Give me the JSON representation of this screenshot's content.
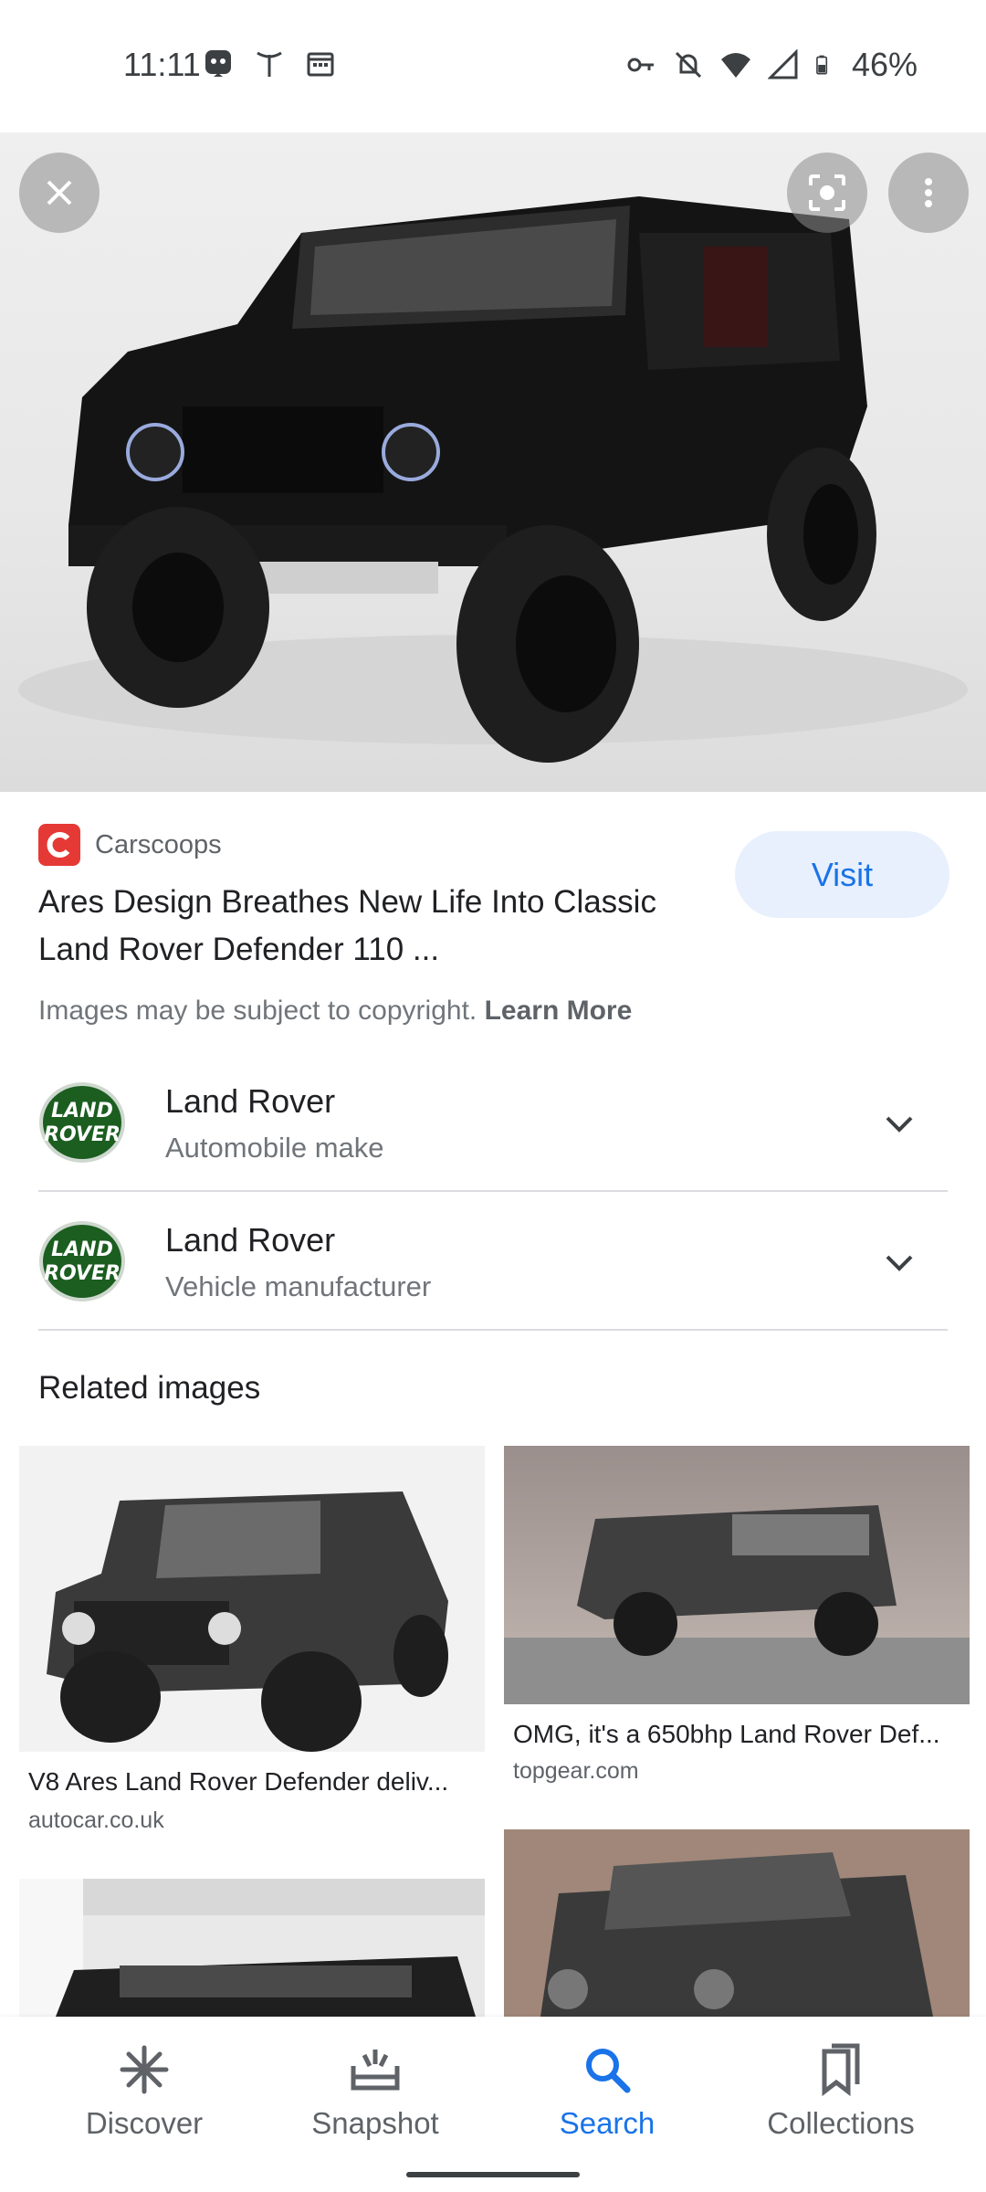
{
  "status_bar": {
    "time": "11:11",
    "battery_percent": "46%",
    "left_icons": [
      "assistant-icon",
      "antenna-icon",
      "calendar-icon"
    ],
    "right_icons": [
      "key-icon",
      "mute-icon",
      "wifi-icon",
      "signal-icon",
      "battery-icon"
    ]
  },
  "hero": {
    "buttons": [
      "close-icon",
      "lens-icon",
      "more-vert-icon"
    ]
  },
  "result": {
    "source": "Carscoops",
    "title": "Ares Design Breathes New Life Into Classic Land Rover Defender 110 ...",
    "visit_label": "Visit",
    "copyright_text": "Images may be subject to copyright.",
    "learn_more": "Learn More"
  },
  "entities": [
    {
      "name": "Land Rover",
      "subtitle": "Automobile make"
    },
    {
      "name": "Land Rover",
      "subtitle": "Vehicle manufacturer"
    }
  ],
  "related": {
    "title": "Related images",
    "items": [
      {
        "title": "V8 Ares Land Rover Defender deliv...",
        "domain": "autocar.co.uk"
      },
      {
        "title": "OMG, it's a 650bhp Land Rover Def...",
        "domain": "topgear.com"
      }
    ]
  },
  "bottom_nav": {
    "items": [
      {
        "label": "Discover",
        "icon": "discover-icon",
        "active": false
      },
      {
        "label": "Snapshot",
        "icon": "snapshot-icon",
        "active": false
      },
      {
        "label": "Search",
        "icon": "search-icon",
        "active": true
      },
      {
        "label": "Collections",
        "icon": "collections-icon",
        "active": false
      }
    ]
  },
  "colors": {
    "accent": "#1a73e8",
    "visit_bg": "#e8f0fe",
    "source_logo": "#e53935",
    "land_rover_green": "#1b5e20"
  }
}
